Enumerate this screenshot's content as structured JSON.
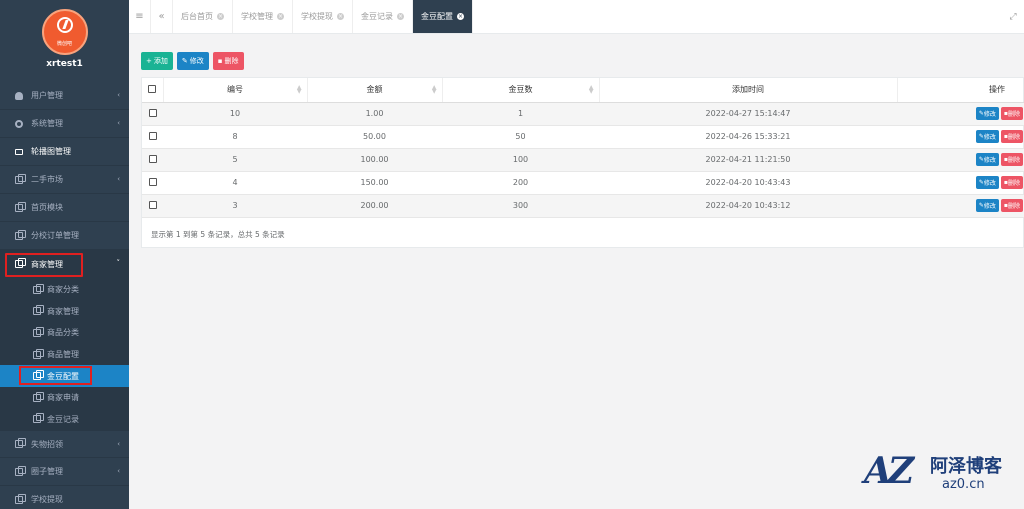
{
  "sidebar": {
    "logo_text": "微创吧",
    "user": "xrtest1",
    "items": [
      {
        "label": "用户管理",
        "icon": "user-icon"
      },
      {
        "label": "系统管理",
        "icon": "gear-icon"
      },
      {
        "label": "轮播图管理",
        "icon": "monitor-icon"
      },
      {
        "label": "二手市场",
        "icon": "copy-icon"
      },
      {
        "label": "首页模块",
        "icon": "copy-icon"
      },
      {
        "label": "分校订单管理",
        "icon": "copy-icon"
      },
      {
        "label": "商家管理",
        "icon": "copy-icon"
      }
    ],
    "sub_items": [
      {
        "label": "商家分类"
      },
      {
        "label": "商家管理"
      },
      {
        "label": "商品分类"
      },
      {
        "label": "商品管理"
      },
      {
        "label": "金豆配置"
      },
      {
        "label": "商家申请"
      },
      {
        "label": "金豆记录"
      }
    ],
    "bottom_items": [
      {
        "label": "失物招领"
      },
      {
        "label": "圈子管理"
      },
      {
        "label": "学校提现"
      }
    ]
  },
  "tabs": [
    {
      "label": "后台首页"
    },
    {
      "label": "学校管理"
    },
    {
      "label": "学校提现"
    },
    {
      "label": "金豆记录"
    },
    {
      "label": "金豆配置"
    }
  ],
  "toolbar": {
    "add": "添加",
    "edit": "修改",
    "delete": "删除"
  },
  "table": {
    "headers": {
      "id": "编号",
      "amount": "金额",
      "beans": "金豆数",
      "time": "添加时间",
      "ops": "操作"
    },
    "rows": [
      {
        "id": "10",
        "amount": "1.00",
        "beans": "1",
        "time": "2022-04-27 15:14:47"
      },
      {
        "id": "8",
        "amount": "50.00",
        "beans": "50",
        "time": "2022-04-26 15:33:21"
      },
      {
        "id": "5",
        "amount": "100.00",
        "beans": "100",
        "time": "2022-04-21 11:21:50"
      },
      {
        "id": "4",
        "amount": "150.00",
        "beans": "200",
        "time": "2022-04-20 10:43:43"
      },
      {
        "id": "3",
        "amount": "200.00",
        "beans": "300",
        "time": "2022-04-20 10:43:12"
      }
    ],
    "row_edit": "修改",
    "row_delete": "删除",
    "footer": "显示第 1 到第 5 条记录，总共 5 条记录"
  },
  "watermark": {
    "mark": "AZ",
    "title": "阿泽博客",
    "site": "az0.cn"
  },
  "colors": {
    "sidebar": "#2f4050",
    "active": "#1c84c6",
    "green": "#1ab394",
    "red": "#ed5565",
    "highlight": "#e02020"
  }
}
